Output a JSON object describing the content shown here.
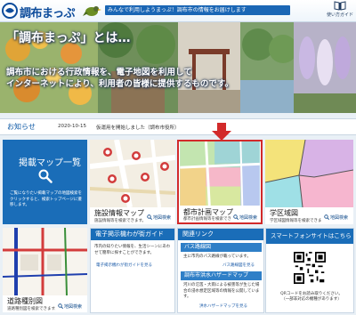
{
  "header": {
    "site_title": "調布まっぷ",
    "tagline": "みんなで利用しようまっぷ！調布市の情報をお届けします",
    "guide_label": "使い方ガイド"
  },
  "hero": {
    "title": "「調布まっぷ」とは…",
    "line1": "調布市における行政情報を、電子地図を利用して",
    "line2": "インターネットにより、利用者の皆様に提供するものです。"
  },
  "notice": {
    "label": "お知らせ",
    "date": "2020-10-15",
    "message": "仮運用を開始しました（調布市役所）"
  },
  "list_tile": {
    "title": "掲載マップ一覧",
    "description": "ご覧になりたい掲載マップの地図検索をクリックすると、検索トップページに遷移します。"
  },
  "tiles": [
    {
      "name": "施設情報マップ",
      "desc": "施設情報等を検索できます。",
      "search": "地図検索"
    },
    {
      "name": "都市計画マップ",
      "desc": "都市計画情報等を検索できます。",
      "search": "地図検索"
    },
    {
      "name": "学区域図",
      "desc": "学区域図情報等を検索できます。",
      "search": "地図検索"
    },
    {
      "name": "道路種別図",
      "desc": "道路種別図を検索できます。",
      "search": "地図検索"
    }
  ],
  "road_panel": {
    "title": "電子掲示機わが街ガイド",
    "text": "市内の知りたい情報を、生活シーンにあわせて簡単に探すことができます。",
    "link": "電子掲示機わが街ガイドを見る"
  },
  "related": {
    "title": "関連リンク",
    "bus_title": "バス路線図",
    "bus_text": "主に市内のバス路線が載っています。",
    "bus_link": "バス路線図を見る",
    "hazard_title": "調布市洪水ハザードマップ",
    "hazard_text": "河川の氾濫・大雨による被害等が生じた場合の浸水想定区域等の情報を公開しています。",
    "hazard_link": "洪水ハザードマップを見る"
  },
  "smartphone": {
    "title": "スマートフォンサイトはこちら",
    "caption": "QRコードをお読み取りください。（一部非対応の機種があります）"
  },
  "colors": {
    "brand_blue": "#1a6db8",
    "highlight_red": "#d22a2a"
  }
}
